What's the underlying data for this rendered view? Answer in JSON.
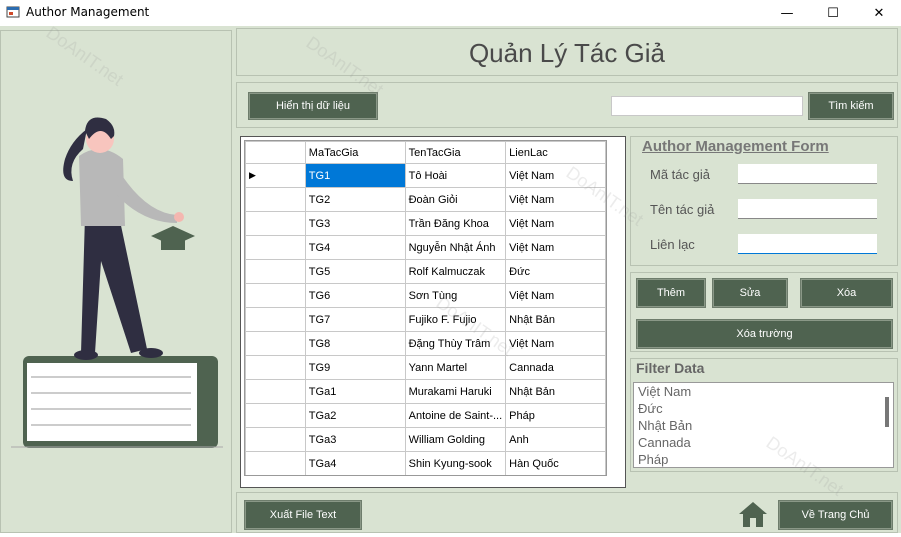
{
  "window": {
    "title": "Author Management",
    "minimize": "—",
    "maximize": "☐",
    "close": "✕"
  },
  "header": {
    "title": "Quản Lý Tác Giả"
  },
  "toolbar": {
    "show_data_label": "Hiển thị dữ liệu",
    "search_label": "Tìm kiếm",
    "search_value": ""
  },
  "grid": {
    "columns": [
      "MaTacGia",
      "TenTacGia",
      "LienLac"
    ],
    "rows": [
      [
        "TG1",
        "Tô Hoài",
        "Việt Nam"
      ],
      [
        "TG2",
        "Đoàn Giỏi",
        "Việt Nam"
      ],
      [
        "TG3",
        "Trần Đăng Khoa",
        "Việt Nam"
      ],
      [
        "TG4",
        "Nguyễn Nhật Ánh",
        "Việt Nam"
      ],
      [
        "TG5",
        "Rolf Kalmuczak",
        "Đức"
      ],
      [
        "TG6",
        "Sơn Tùng",
        "Việt Nam"
      ],
      [
        "TG7",
        "Fujiko F. Fujio",
        "Nhật Bản"
      ],
      [
        "TG8",
        "Đặng Thùy Trâm",
        "Việt Nam"
      ],
      [
        "TG9",
        "Yann Martel",
        "Cannada"
      ],
      [
        "TGa1",
        "Murakami Haruki",
        "Nhật Bản"
      ],
      [
        "TGa2",
        "Antoine de Saint-...",
        "Pháp"
      ],
      [
        "TGa3",
        "William Golding",
        "Anh"
      ],
      [
        "TGa4",
        "Shin Kyung-sook",
        "Hàn Quốc"
      ]
    ],
    "selected_row_marker": "▶"
  },
  "form": {
    "header": "Author Management Form",
    "author_id_label": "Mã tác giả",
    "author_name_label": "Tên tác giả",
    "contact_label": "Liên lạc",
    "author_id_value": "",
    "author_name_value": "",
    "contact_value": ""
  },
  "actions": {
    "add_label": "Thêm",
    "edit_label": "Sửa",
    "delete_label": "Xóa",
    "clear_label": "Xóa trường"
  },
  "filter": {
    "title": "Filter Data",
    "items": [
      "Việt Nam",
      "Đức",
      "Nhật Bản",
      "Cannada",
      "Pháp"
    ]
  },
  "footer": {
    "export_label": "Xuất File Text",
    "home_label": "Về Trang Chủ"
  },
  "watermark": {
    "text": "DoAnIT.net"
  },
  "colors": {
    "background": "#d9e3d2",
    "button": "#4f6350",
    "selected": "#0078d7"
  },
  "icons": {
    "app": "app-icon",
    "home": "home-icon"
  }
}
